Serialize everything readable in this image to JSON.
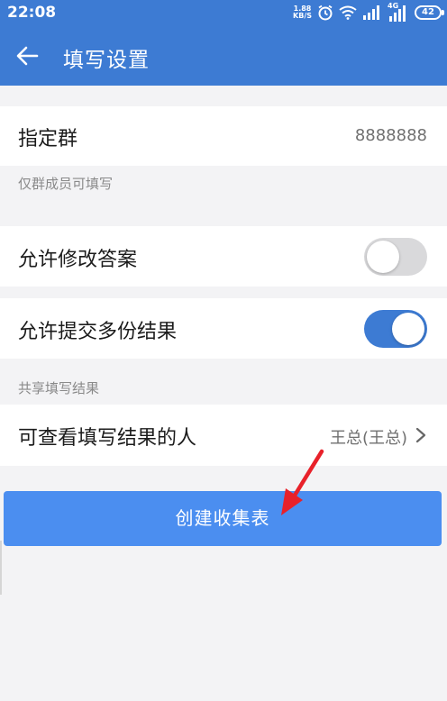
{
  "status_bar": {
    "time": "22:08",
    "net_speed_value": "1.88",
    "net_speed_unit": "KB/S",
    "network": "4G",
    "battery": "42"
  },
  "app_bar": {
    "title": "填写设置",
    "back_icon": "arrow-left-icon"
  },
  "settings": {
    "group": {
      "label": "指定群",
      "value": "8888888"
    },
    "group_hint": "仅群成员可填写",
    "allow_edit": {
      "label": "允许修改答案",
      "enabled": false
    },
    "allow_multiple": {
      "label": "允许提交多份结果",
      "enabled": true
    },
    "share_hint": "共享填写结果",
    "viewers": {
      "label": "可查看填写结果的人",
      "value": "王总(王总)"
    }
  },
  "create_button": {
    "label": "创建收集表"
  },
  "colors": {
    "primary": "#3d7bd3",
    "button": "#4b8ef0",
    "annotation_arrow": "#e8212a"
  }
}
